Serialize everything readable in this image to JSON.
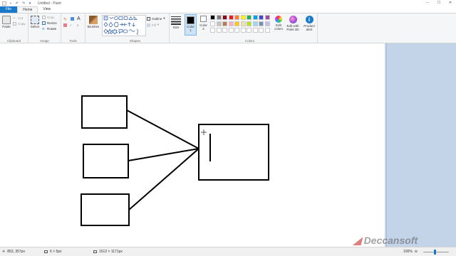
{
  "window": {
    "title": "Untitled - Paint",
    "quick_access": [
      "save-icon",
      "undo-icon",
      "redo-icon",
      "dropdown-icon"
    ],
    "controls": [
      "–",
      "☐",
      "✕"
    ]
  },
  "tabs": {
    "file": "File",
    "home": "Home",
    "view": "View"
  },
  "ribbon": {
    "clipboard": {
      "paste": "Paste",
      "cut": "Cut",
      "copy": "Copy",
      "label": "Clipboard"
    },
    "image": {
      "select": "Select",
      "crop": "Crop",
      "resize": "Resize",
      "rotate": "Rotate",
      "label": "Image"
    },
    "tools": {
      "label": "Tools",
      "brushes": "Brushes"
    },
    "shapes": {
      "outline": "Outline",
      "fill": "Fill",
      "label": "Shapes"
    },
    "size": {
      "label": "Size"
    },
    "colors": {
      "color1": "Color\n1",
      "color2": "Color\n2",
      "label": "Colors",
      "edit_colors": "Edit\ncolors",
      "palette_row1": [
        "#000000",
        "#7f7f7f",
        "#880015",
        "#ed1c24",
        "#ff7f27",
        "#fff200",
        "#22b14c",
        "#00a2e8",
        "#3f48cc",
        "#a349a4"
      ],
      "palette_row2": [
        "#ffffff",
        "#c3c3c3",
        "#b97a57",
        "#ffaec9",
        "#ffc90e",
        "#efe4b0",
        "#b5e61d",
        "#99d9ea",
        "#7092be",
        "#c8bfe7"
      ]
    },
    "paint3d": "Edit with\nPaint 3D",
    "product_alert": "Product\nalert"
  },
  "status": {
    "cursor": "853, 357px",
    "selection": "6 × 5px",
    "canvas_size": "1612 × 1171px",
    "zoom": "100%"
  },
  "watermark": "Deccansoft"
}
